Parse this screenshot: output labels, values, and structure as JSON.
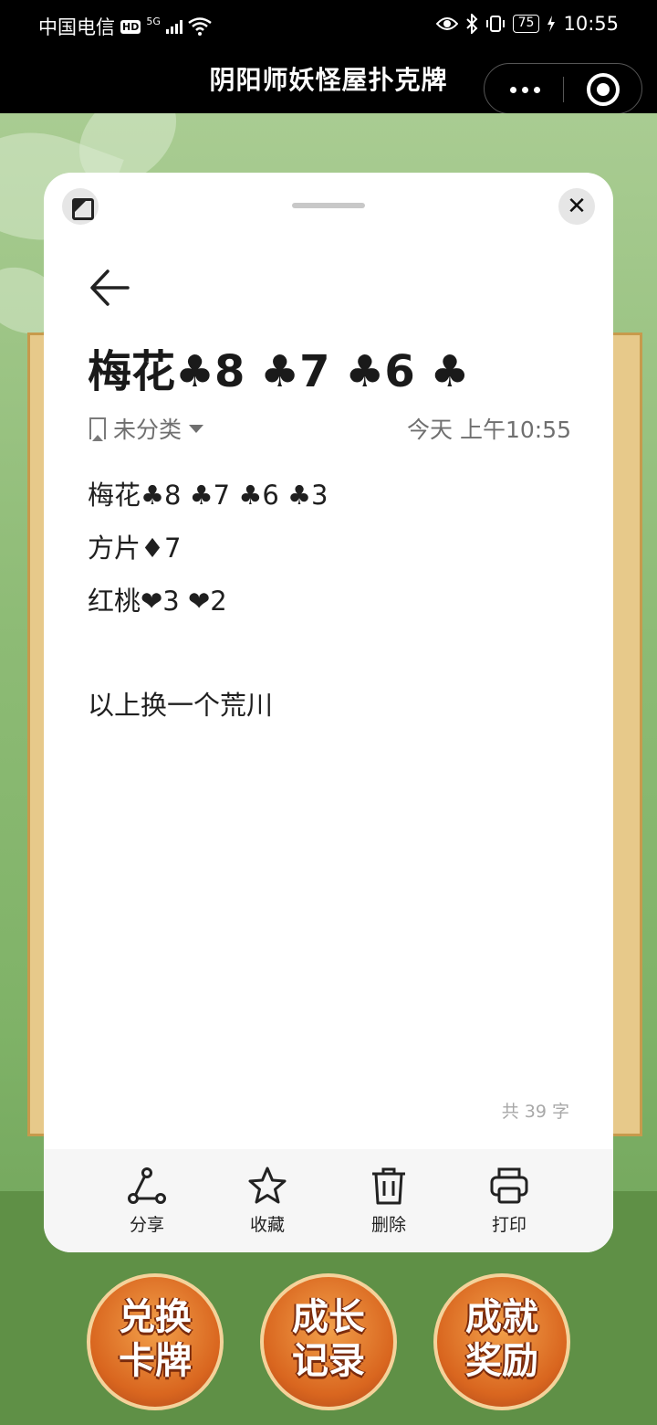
{
  "status_bar": {
    "carrier": "中国电信",
    "hd": "HD",
    "network": "5G",
    "battery": "75",
    "time": "10:55"
  },
  "app": {
    "title": "阴阳师妖怪屋扑克牌"
  },
  "note": {
    "title": "梅花♣8 ♣7 ♣6 ♣",
    "category": "未分类",
    "timestamp": "今天 上午10:55",
    "lines": [
      "梅花♣8 ♣7 ♣6 ♣3",
      "方片♦7",
      "红桃❤3 ❤2",
      "",
      "以上换一个荒川"
    ],
    "word_count": "共 39 字"
  },
  "toolbar": {
    "share": "分享",
    "favorite": "收藏",
    "delete": "删除",
    "print": "打印"
  },
  "game_buttons": [
    {
      "line1": "兑换",
      "line2": "卡牌"
    },
    {
      "line1": "成长",
      "line2": "记录"
    },
    {
      "line1": "成就",
      "line2": "奖励"
    }
  ]
}
